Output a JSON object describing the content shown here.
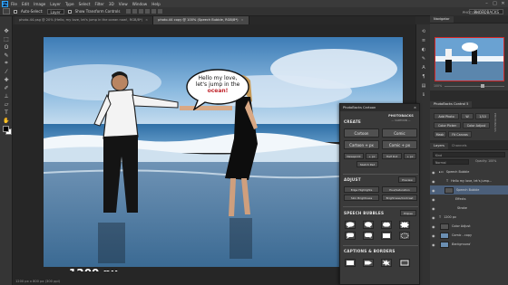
{
  "menubar": {
    "logo": "Ps",
    "items": [
      "File",
      "Edit",
      "Image",
      "Layer",
      "Type",
      "Select",
      "Filter",
      "3D",
      "View",
      "Window",
      "Help"
    ],
    "window_controls": [
      "–",
      "□",
      "✕"
    ]
  },
  "options": {
    "auto_select_label": "Auto-Select:",
    "auto_select_value": "Layer",
    "show_transform_label": "Show Transform Controls",
    "workspace": "PHOTOBACKS"
  },
  "tabs": [
    {
      "label": "photo-44.psg @ 20% (Hello, my love, let's jump in the ocean now!, RGB/8*)",
      "active": false
    },
    {
      "label": "photo-44 copy @ 100% (Speech Bubble, RGB/8*)",
      "active": true
    }
  ],
  "canvas": {
    "bubble_lines": [
      "Hello my love,",
      "let's jump in the",
      "ocean!"
    ],
    "size_label": "1200 px"
  },
  "statusbar": {
    "text": "1200 px x 800 px (300 ppi)"
  },
  "navigator": {
    "tabs": [
      "Navigator"
    ],
    "zoom": "100%"
  },
  "photobacks_panel": {
    "title": "PhotoBacks Control 5",
    "buttons": [
      "Add Photo",
      "W",
      "1/10",
      "Color Picker",
      "Color Adjust",
      "Mask",
      "Fit Canvas"
    ],
    "brand": "PHOTOBACKS"
  },
  "layers": {
    "tabs": [
      "Layers",
      "Channels"
    ],
    "filter": "Kind",
    "blend": "Normal",
    "opacity": "Opacity: 100%",
    "rows": [
      {
        "name": "Speech Bubble",
        "indent": 0,
        "selected": false,
        "icon": "folder"
      },
      {
        "name": "Hello my love, let's jump...",
        "indent": 1,
        "selected": false,
        "icon": "text"
      },
      {
        "name": "Speech Bubble",
        "indent": 1,
        "selected": true,
        "icon": "shape"
      },
      {
        "name": "Effects",
        "indent": 2,
        "selected": false,
        "icon": "fx"
      },
      {
        "name": "Stroke",
        "indent": 2,
        "selected": false,
        "icon": "fx"
      },
      {
        "name": "1200 px",
        "indent": 0,
        "selected": false,
        "icon": "text"
      },
      {
        "name": "Color Adjust",
        "indent": 0,
        "selected": false,
        "icon": "adjust"
      },
      {
        "name": "Comic - copy",
        "indent": 0,
        "selected": false,
        "icon": "image"
      },
      {
        "name": "Background",
        "indent": 0,
        "selected": false,
        "icon": "image"
      }
    ]
  },
  "plugin": {
    "title": "PhotoBacks Cartoon",
    "create_label": "CREATE",
    "logo_main": "PHOTOBACKS",
    "logo_sub": "— CARTOON —",
    "create_buttons": [
      "Cartoon",
      "Comic",
      "Cartoon + px",
      "Comic + px"
    ],
    "small_row1": [
      "Newsprint",
      "+ px",
      "Half Dot",
      "+ px"
    ],
    "small_row2": [
      "Sketch Pad"
    ],
    "adjust_label": "ADJUST",
    "adjust_preview": "Preview",
    "adjust_buttons": [
      "Edge Highlights",
      "Hue/Saturation",
      "Skin Brightness",
      "Brightness/Contrast"
    ],
    "bubbles_label": "SPEECH BUBBLES",
    "bubbles_tag": "Ellipse",
    "captions_label": "CAPTIONS & BORDERS"
  },
  "colors": {
    "accent": "#31a8ff",
    "selected_layer": "#4b5f7a",
    "bubble_word": "#c0242b"
  }
}
